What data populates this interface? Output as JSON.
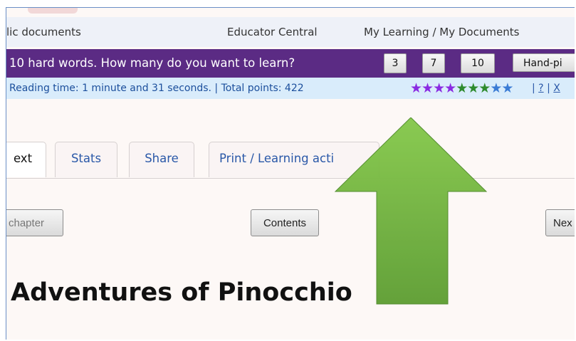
{
  "navbar": {
    "public_documents": "lic documents",
    "educator_central": "Educator Central",
    "my_learning": "My Learning / My Documents"
  },
  "hard_words_bar": {
    "question": "10 hard words. How many do you want to learn?",
    "options": [
      "3",
      "7",
      "10"
    ],
    "handpicked_label": "Hand-pi"
  },
  "info_bar": {
    "text": "Reading time: 1 minute and 31 seconds. | Total points: 422",
    "star_count": 9,
    "star_colors": [
      "#8a2be2",
      "#8a2be2",
      "#8a2be2",
      "#8a2be2",
      "#2e8b2e",
      "#2e8b2e",
      "#2e8b2e",
      "#3a7bd5",
      "#3a7bd5"
    ],
    "sep1": " | ",
    "help_link": "?",
    "sep2": " | ",
    "close_link": "X"
  },
  "tabs": [
    {
      "label": "ext",
      "active": true
    },
    {
      "label": "Stats",
      "active": false
    },
    {
      "label": "Share",
      "active": false
    },
    {
      "label": "Print / Learning acti",
      "active": false
    }
  ],
  "nav_buttons": {
    "prev": "chapter",
    "contents": "Contents",
    "next": "Nex"
  },
  "document_title": "Adventures of Pinocchio",
  "colors": {
    "purple_bar": "#5b2b84",
    "info_bar": "#d9ecfb",
    "arrow_green": "#6fb43f"
  }
}
